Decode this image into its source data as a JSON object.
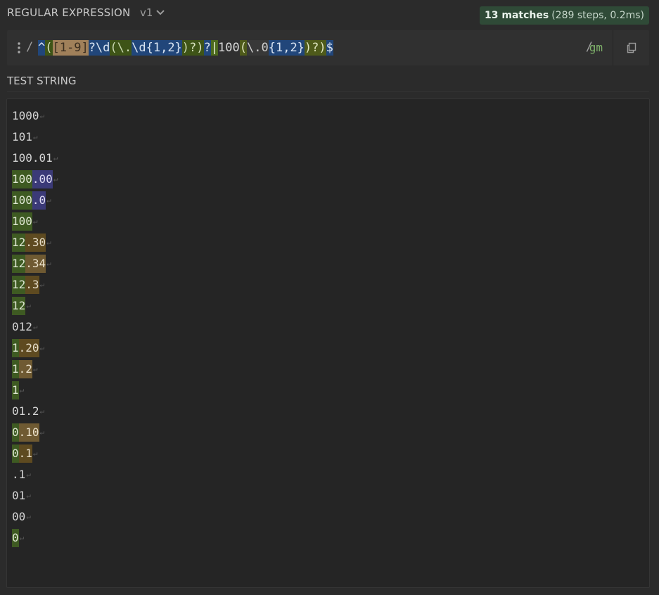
{
  "header": {
    "title": "REGULAR EXPRESSION",
    "version": "v1",
    "match_count": "13 matches",
    "match_info": "(289 steps, 0.2ms)"
  },
  "regex": {
    "open_delimiter": "/",
    "close_delimiter": "/",
    "flags": "gm",
    "tokens": [
      {
        "text": "^",
        "kind": "anchor"
      },
      {
        "text": "(",
        "kind": "group"
      },
      {
        "text": "[1-9]",
        "kind": "class"
      },
      {
        "text": "?\\d",
        "kind": "quant"
      },
      {
        "text": "(",
        "kind": "esc"
      },
      {
        "text": "\\.",
        "kind": "esc"
      },
      {
        "text": "\\d{1,2}",
        "kind": "escd"
      },
      {
        "text": ")",
        "kind": "esc"
      },
      {
        "text": "?)",
        "kind": "group"
      },
      {
        "text": "?",
        "kind": "quant"
      },
      {
        "text": "|",
        "kind": "alt"
      },
      {
        "text": "100",
        "kind": "plain"
      },
      {
        "text": "(",
        "kind": "group2"
      },
      {
        "text": "\\.",
        "kind": "esc2"
      },
      {
        "text": "0",
        "kind": "esc2"
      },
      {
        "text": "{1,2}",
        "kind": "escd"
      },
      {
        "text": ")?)",
        "kind": "group2"
      },
      {
        "text": "$",
        "kind": "anchor"
      }
    ]
  },
  "test_string": {
    "title": "TEST STRING",
    "newline_glyph": "↵",
    "lines": [
      {
        "segments": [
          {
            "text": "1000",
            "match": ""
          }
        ]
      },
      {
        "segments": [
          {
            "text": "101",
            "match": ""
          }
        ]
      },
      {
        "segments": [
          {
            "text": "100.01",
            "match": ""
          }
        ]
      },
      {
        "segments": [
          {
            "text": "100",
            "match": "green"
          },
          {
            "text": ".00",
            "match": "purple"
          }
        ]
      },
      {
        "segments": [
          {
            "text": "100",
            "match": "green"
          },
          {
            "text": ".0",
            "match": "purple"
          }
        ]
      },
      {
        "segments": [
          {
            "text": "100",
            "match": "green"
          }
        ]
      },
      {
        "segments": [
          {
            "text": "12",
            "match": "green"
          },
          {
            "text": ".30",
            "match": "brown"
          }
        ]
      },
      {
        "segments": [
          {
            "text": "12",
            "match": "green"
          },
          {
            "text": ".34",
            "match": "brownlight"
          }
        ]
      },
      {
        "segments": [
          {
            "text": "12",
            "match": "green"
          },
          {
            "text": ".3",
            "match": "brown"
          }
        ]
      },
      {
        "segments": [
          {
            "text": "12",
            "match": "green"
          }
        ]
      },
      {
        "segments": [
          {
            "text": "012",
            "match": ""
          }
        ]
      },
      {
        "segments": [
          {
            "text": "1",
            "match": "green"
          },
          {
            "text": ".20",
            "match": "brown"
          }
        ]
      },
      {
        "segments": [
          {
            "text": "1",
            "match": "green"
          },
          {
            "text": ".2",
            "match": "brownlight"
          }
        ]
      },
      {
        "segments": [
          {
            "text": "1",
            "match": "green"
          }
        ]
      },
      {
        "segments": [
          {
            "text": "01.2",
            "match": ""
          }
        ]
      },
      {
        "segments": [
          {
            "text": "0",
            "match": "green"
          },
          {
            "text": ".10",
            "match": "brownlight"
          }
        ]
      },
      {
        "segments": [
          {
            "text": "0",
            "match": "green"
          },
          {
            "text": ".1",
            "match": "brown"
          }
        ]
      },
      {
        "segments": [
          {
            "text": ".1",
            "match": ""
          }
        ]
      },
      {
        "segments": [
          {
            "text": "01",
            "match": ""
          }
        ]
      },
      {
        "segments": [
          {
            "text": "00",
            "match": ""
          }
        ]
      },
      {
        "segments": [
          {
            "text": "0",
            "match": "green"
          }
        ]
      }
    ]
  },
  "icons": {
    "menu": "vertical-dots-icon",
    "version_chevron": "chevron-down-icon",
    "copy": "copy-icon"
  },
  "colors": {
    "background": "#2b2b2b",
    "badge": "#2f4a37",
    "match_green": "#3e5a22",
    "match_purple": "#3b3a78",
    "match_brown": "#5e4a20",
    "flags": "#7fb26a"
  }
}
